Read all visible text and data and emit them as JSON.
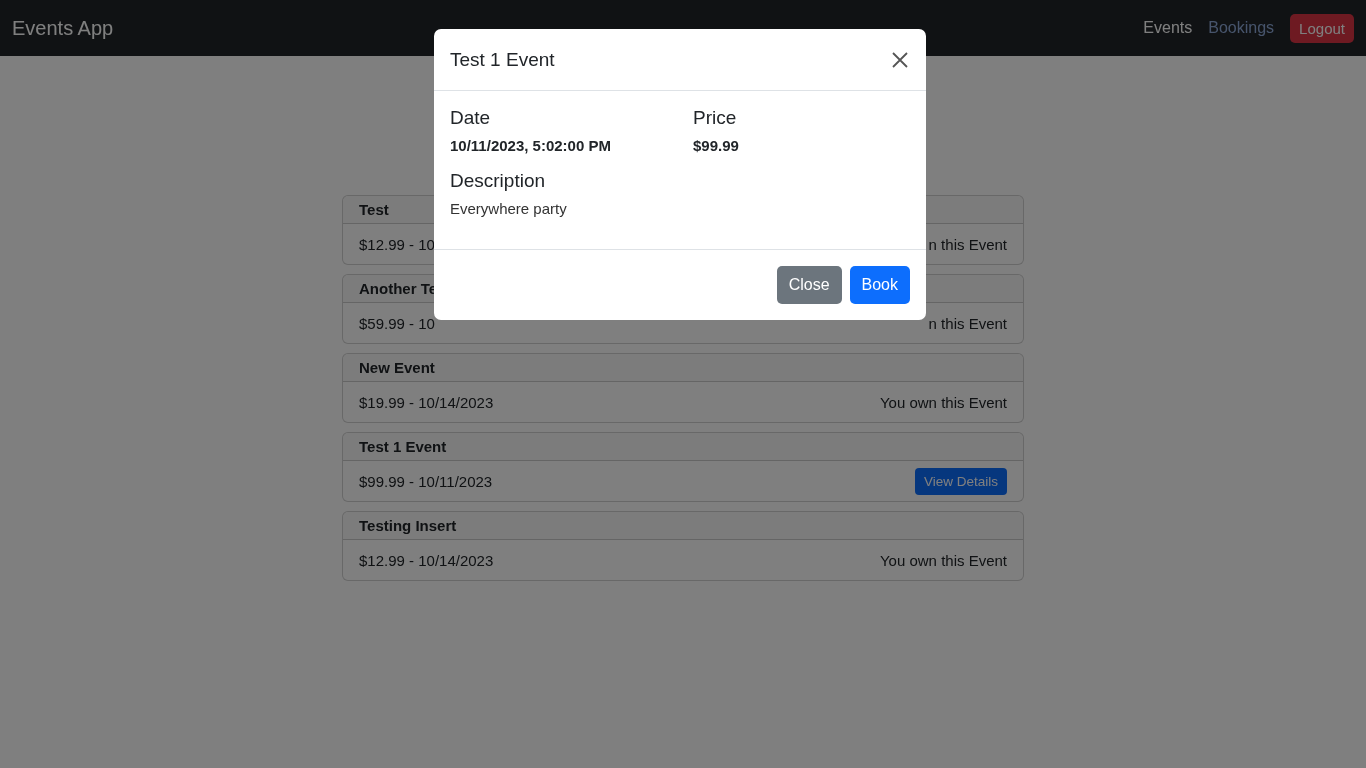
{
  "navbar": {
    "brand": "Events App",
    "items": [
      {
        "label": "Events",
        "selected": true
      },
      {
        "label": "Bookings",
        "selected": false
      }
    ],
    "logout": "Logout"
  },
  "events": [
    {
      "title": "Test",
      "summary": "$12.99 - 10",
      "action": {
        "kind": "text",
        "label": "n this Event"
      }
    },
    {
      "title": "Another Te",
      "summary": "$59.99 - 10",
      "action": {
        "kind": "text",
        "label": "n this Event"
      }
    },
    {
      "title": "New Event",
      "summary": "$19.99 - 10/14/2023",
      "action": {
        "kind": "text",
        "label": "You own this Event"
      }
    },
    {
      "title": "Test 1 Event",
      "summary": "$99.99 - 10/11/2023",
      "action": {
        "kind": "button",
        "label": "View Details"
      }
    },
    {
      "title": "Testing Insert",
      "summary": "$12.99 - 10/14/2023",
      "action": {
        "kind": "text",
        "label": "You own this Event"
      }
    }
  ],
  "modal": {
    "title": "Test 1 Event",
    "date_label": "Date",
    "date": "10/11/2023, 5:02:00 PM",
    "price_label": "Price",
    "price": "$99.99",
    "description_label": "Description",
    "description": "Everywhere party",
    "buttons": [
      {
        "label": "Close",
        "kind": "secondary"
      },
      {
        "label": "Book",
        "kind": "primary"
      }
    ]
  }
}
